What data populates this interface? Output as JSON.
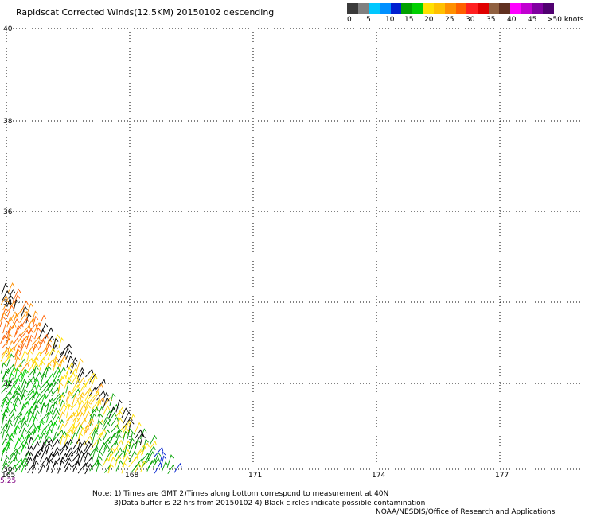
{
  "title": "Rapidscat Corrected Winds(12.5KM) 20150102 descending",
  "colorbar": {
    "colors": [
      "#3a3a3a",
      "#808080",
      "#00c8ff",
      "#0090ff",
      "#0020d0",
      "#00a000",
      "#00d000",
      "#ffe000",
      "#ffc000",
      "#ff9000",
      "#ff6000",
      "#ff2020",
      "#e00000",
      "#906040",
      "#603020",
      "#ff00ff",
      "#c000d0",
      "#8000a0",
      "#500070"
    ],
    "labels": [
      "0",
      "5",
      "10",
      "15",
      "20",
      "25",
      "30",
      "35",
      "40",
      "45",
      ">50 knots"
    ]
  },
  "map": {
    "lat_labels": [
      "40",
      "38",
      "36",
      "34",
      "32",
      "30"
    ],
    "lon_labels": [
      "165",
      "168",
      "171",
      "174",
      "177"
    ],
    "time_label": "5:25"
  },
  "notes": {
    "line1": "Note: 1) Times are GMT 2)Times along bottom correspond to measurement at 40N",
    "line2": "3)Data buffer is 22 hrs from 20150102 4) Black circles indicate possible contamination",
    "line3": "NOAA/NESDIS/Office of Research and Applications"
  }
}
